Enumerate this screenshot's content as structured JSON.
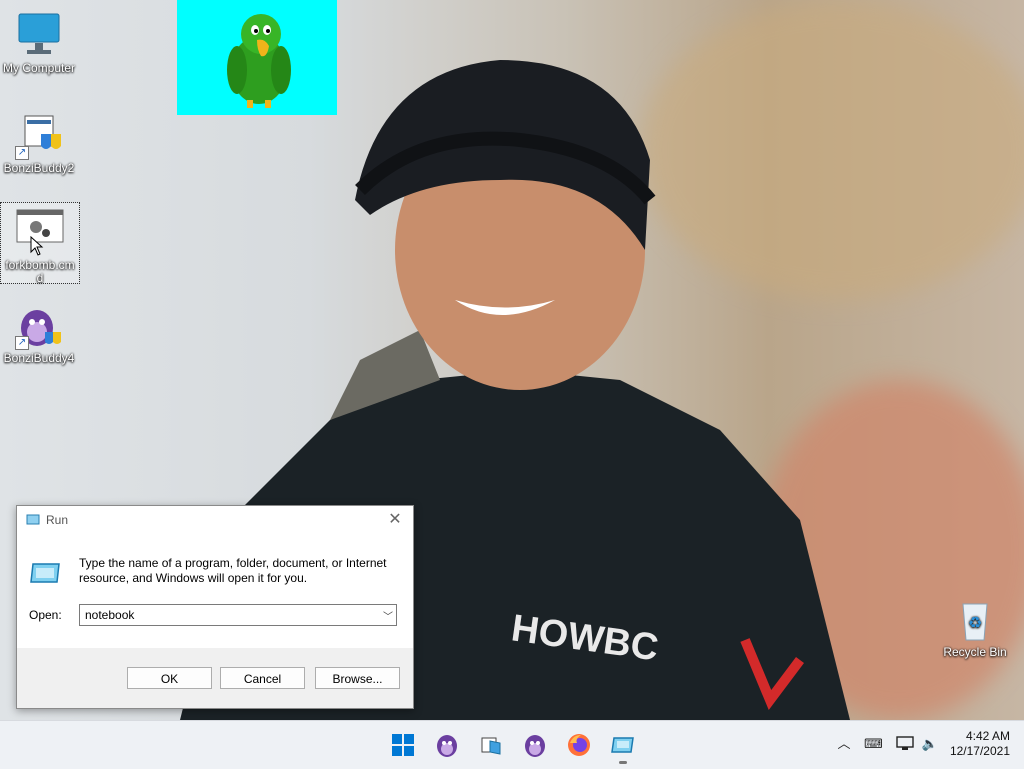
{
  "desktop": {
    "icons": [
      {
        "label": "My Computer",
        "icon": "monitor-icon"
      },
      {
        "label": "BonziBuddy2",
        "icon": "bonzi-installer-icon"
      },
      {
        "label": "forkbomb.cmd",
        "icon": "cmd-script-icon"
      },
      {
        "label": "BonziBuddy4",
        "icon": "purple-gorilla-icon"
      },
      {
        "label": "Recycle Bin",
        "icon": "recycle-bin-icon"
      }
    ]
  },
  "run_dialog": {
    "title": "Run",
    "description": "Type the name of a program, folder, document, or Internet resource, and Windows will open it for you.",
    "open_label": "Open:",
    "open_value": "notebook",
    "ok_label": "OK",
    "cancel_label": "Cancel",
    "browse_label": "Browse..."
  },
  "taskbar": {
    "pinned": [
      "windows-start-icon",
      "bonzi-gorilla-icon",
      "file-explorer-icon",
      "bonzi-gorilla-icon",
      "firefox-icon",
      "run-dialog-icon"
    ],
    "tray": [
      "chevron-up-icon",
      "keyboard-icon",
      "network-icon",
      "volume-muted-icon"
    ],
    "time": "4:42 AM",
    "date": "12/17/2021"
  },
  "colors": {
    "accent": "#0078d4",
    "parrot_background": "#00ffff",
    "parrot_green": "#2e9e1f"
  }
}
